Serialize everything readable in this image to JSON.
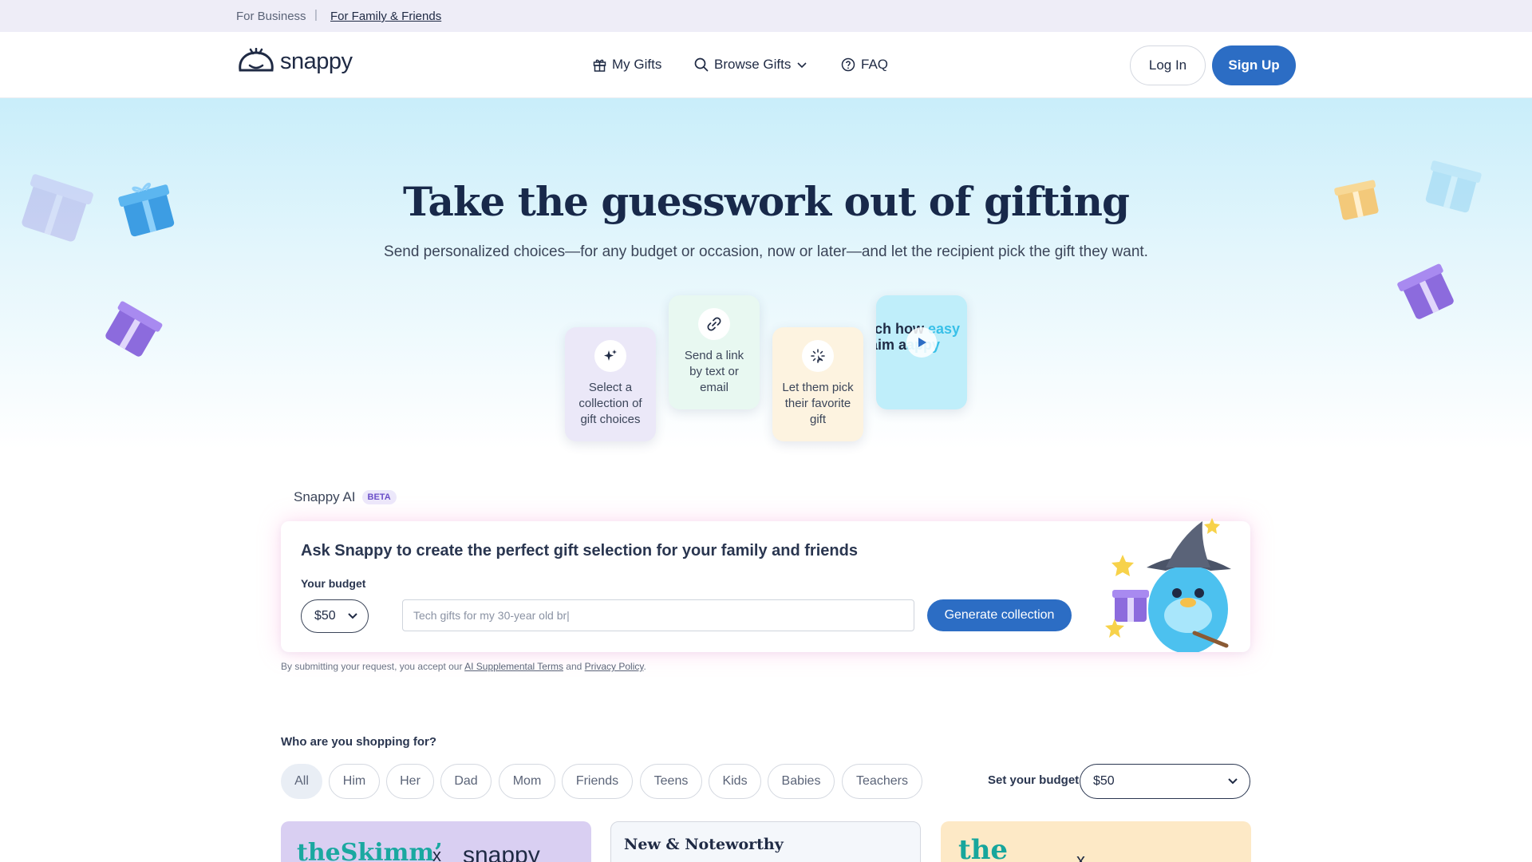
{
  "topbar": {
    "business": "For Business",
    "separator": "|",
    "family": "For Family & Friends"
  },
  "header": {
    "logo_text": "snappy",
    "nav": {
      "my_gifts": "My Gifts",
      "browse_gifts": "Browse Gifts",
      "faq": "FAQ"
    },
    "login": "Log In",
    "signup": "Sign Up"
  },
  "hero": {
    "title": "Take the guesswork out of gifting",
    "subtitle": "Send personalized choices—for any budget or occasion, now or later—and let the recipient pick the gift they want.",
    "steps": [
      {
        "text": "Select a collection of gift choices",
        "icon": "sparkles-icon"
      },
      {
        "text": "Send a link by text or email",
        "icon": "link-icon"
      },
      {
        "text": "Let them pick their favorite gift",
        "icon": "click-icon"
      }
    ],
    "video": {
      "line1_a": "tch how ",
      "line1_b": "easy",
      "line2_a": "aim a",
      "line2_b": "appy"
    }
  },
  "ai": {
    "label": "Snappy AI",
    "beta": "BETA",
    "heading": "Ask Snappy to create the perfect gift selection for your family and friends",
    "budget_label": "Your budget",
    "budget_value": "$50",
    "input_placeholder": "Tech gifts for my 30-year old br|",
    "generate": "Generate collection",
    "terms_prefix": "By submitting your request, you accept our ",
    "terms_link": "AI Supplemental Terms",
    "terms_and": " and ",
    "privacy_link": "Privacy Policy",
    "terms_suffix": "."
  },
  "shopping": {
    "title": "Who are you shopping for?",
    "chips": [
      "All",
      "Him",
      "Her",
      "Dad",
      "Mom",
      "Friends",
      "Teens",
      "Kids",
      "Babies",
      "Teachers"
    ],
    "budget_label": "Set your budget",
    "budget_value": "$50"
  },
  "cards": {
    "skimm": "theSkimm’",
    "x": "x",
    "snappy": "snappy",
    "new_noteworthy": "New & Noteworthy",
    "the": "the"
  },
  "colors": {
    "primary": "#2c6dc4",
    "topbar": "#eeedf7",
    "hero_top": "#c9eefa",
    "text_dark": "#1f2a44"
  }
}
